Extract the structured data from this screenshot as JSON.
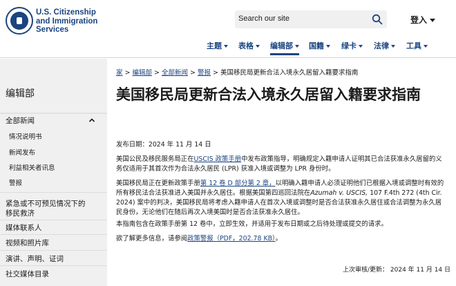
{
  "header": {
    "agency_line1": "U.S. Citizenship",
    "agency_line2": "and Immigration",
    "agency_line3": "Services",
    "search_placeholder": "Search our site",
    "login_label": "登入"
  },
  "nav": {
    "items": [
      {
        "label": "主题"
      },
      {
        "label": "表格"
      },
      {
        "label": "编辑部"
      },
      {
        "label": "国籍"
      },
      {
        "label": "绿卡"
      },
      {
        "label": "法律"
      },
      {
        "label": "工具"
      }
    ]
  },
  "sidebar": {
    "title": "编辑部",
    "section_label": "全部新闻",
    "sub_items": [
      "情况说明书",
      "新闻发布",
      "利益相关者讯息",
      "警报"
    ],
    "other_items": [
      "紧急或不可预见情况下的",
      "移民救济",
      "媒体联系人",
      "视频和照片库",
      "演讲、声明、证词",
      "社交媒体目录"
    ]
  },
  "breadcrumb": {
    "home": "家",
    "crumb1": "编辑部",
    "crumb2": "全部新闻",
    "crumb3": "警报",
    "current": "美国移民局更新合法入境永久居留入籍要求指南"
  },
  "article": {
    "title": "美国移民局更新合法入境永久居留入籍要求指南",
    "date": "发布日期：2024 年 11 月 14 日",
    "p1_before": "美国公民及移民服务局正在",
    "p1_link": "USCIS 政策手册",
    "p1_after": "中发布政策指导，明确规定入籍申请人证明其已合法获准永久居留的义务仅适用于其首次作为合法永久居民 (LPR) 获准入境或调整为 LPR 身份时。",
    "p2_before": "美国移民局正在更新政策手册",
    "p2_link": "第 12 卷 D 部分第 2 章，",
    "p2_mid": "以明确入籍申请人必须证明他们已根据入境或调整时有效的所有移民法合法获准进入美国并永久居住。根据美国第四巡回法院在",
    "p2_case": "Azumah v. USCIS,",
    "p2_after": " 107 F.4th 272 (4th Cir. 2024) 案中的判决，美国移民局将考虑入籍申请人在首次入境或调整时是否合法获准永久居住或合法调整为永久居民身份，无论他们在随后再次入境美国时是否合法获准永久居住。",
    "p3": "本指南包含在政策手册第 12 卷中，立即生效，并适用于发布日期或之后待处理或提交的请求。",
    "p4_before": "欲了解更多信息，请参阅",
    "p4_link": "政策警报（PDF，202.78 KB）",
    "p4_after": "。",
    "updated": "上次审核/更新：  2024 年 11 月 14 日"
  }
}
